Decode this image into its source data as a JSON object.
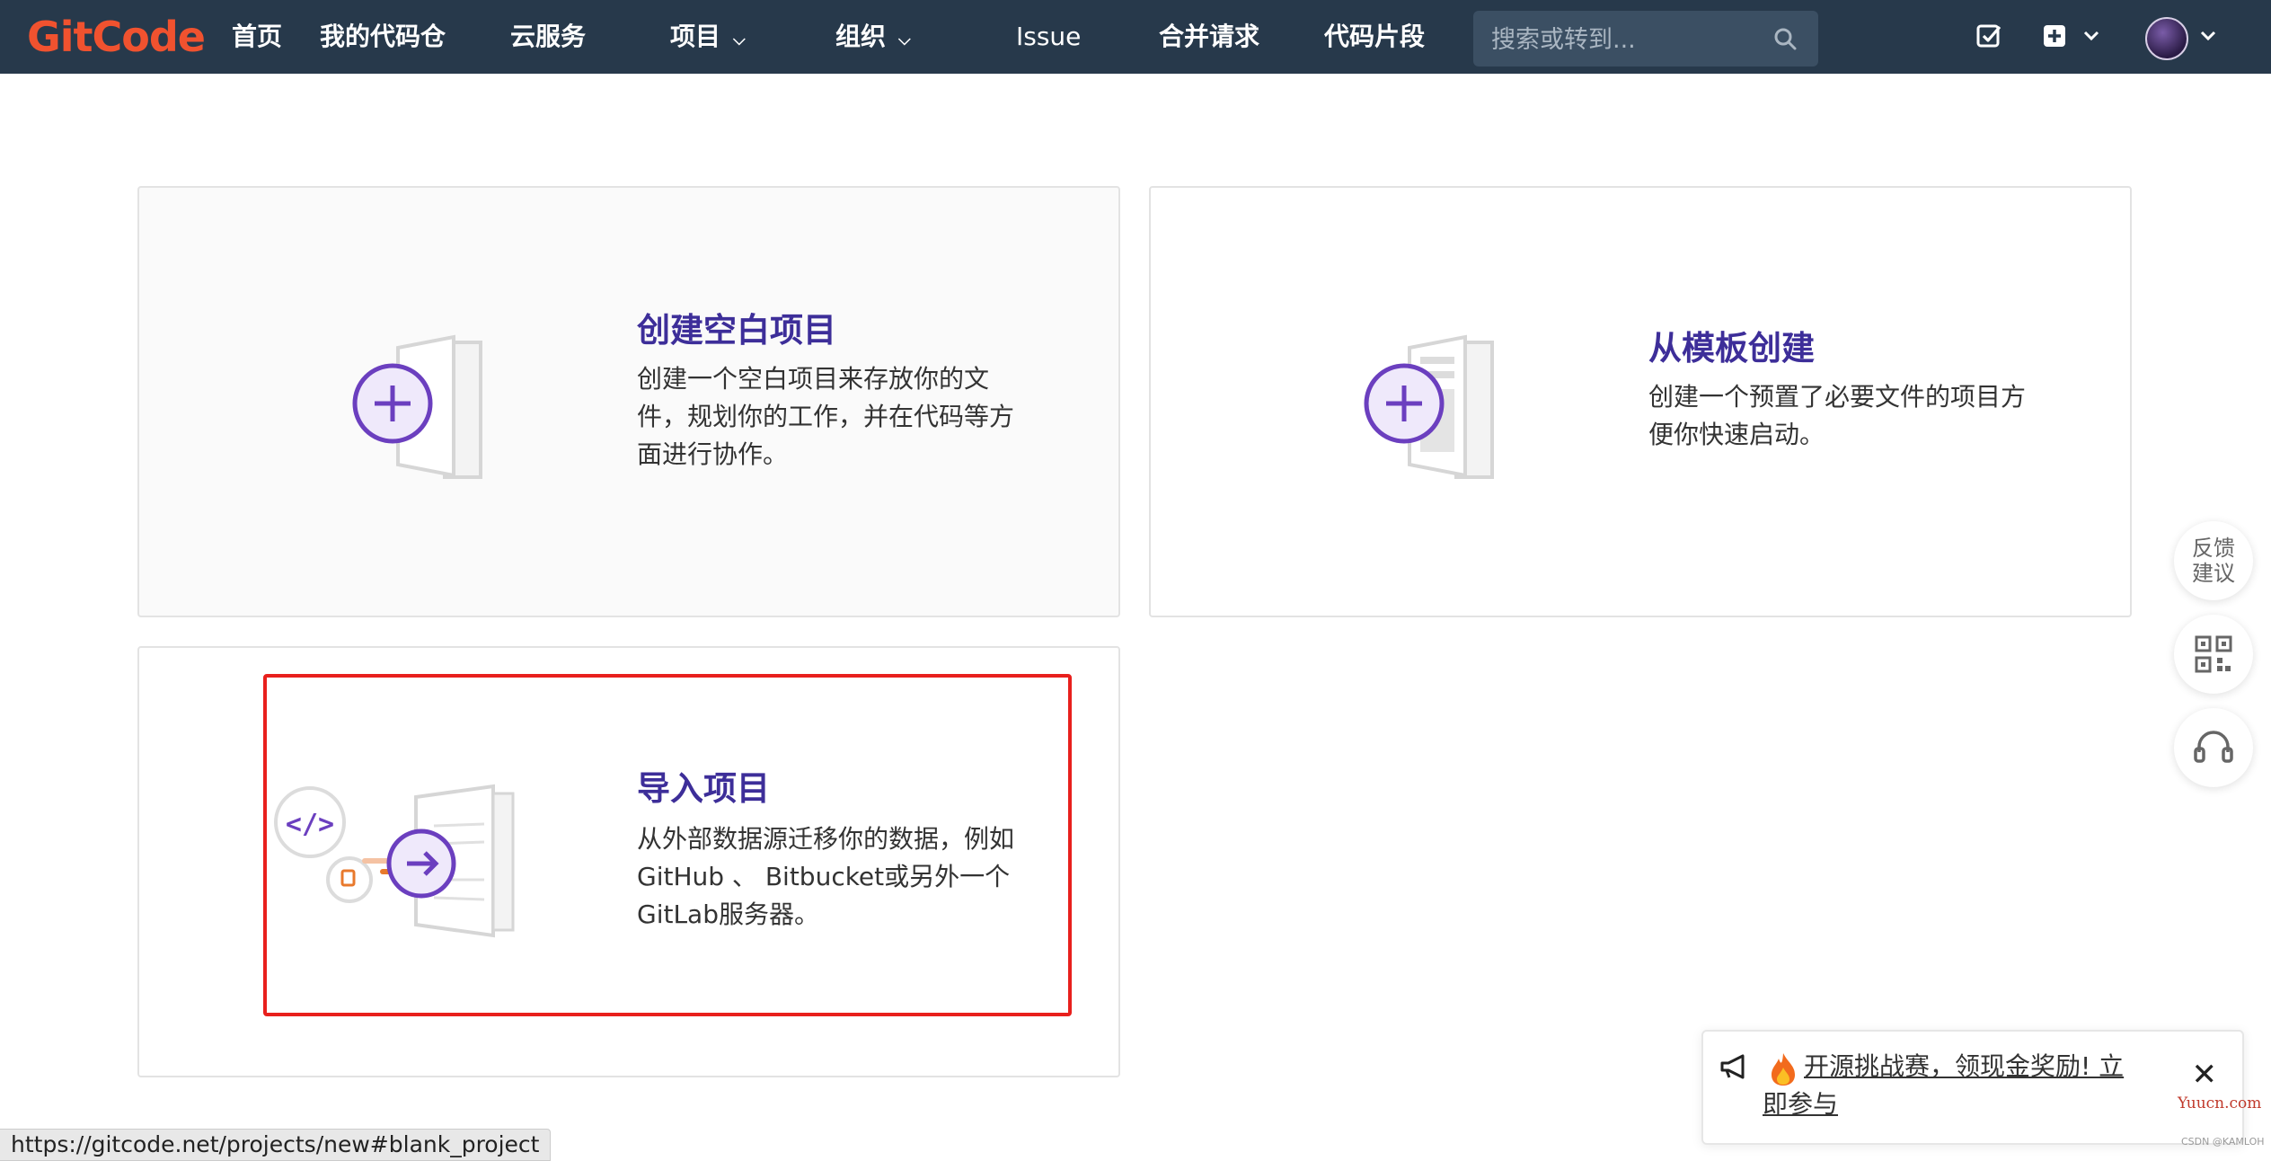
{
  "header": {
    "logo": "GitCode",
    "nav": [
      {
        "label": "首页"
      },
      {
        "label": "我的代码仓"
      },
      {
        "label": "云服务"
      },
      {
        "label": "项目"
      },
      {
        "label": "组织"
      },
      {
        "label": "Issue"
      },
      {
        "label": "合并请求"
      },
      {
        "label": "代码片段"
      }
    ],
    "search_placeholder": "搜索或转到..."
  },
  "cards": [
    {
      "title": "创建空白项目",
      "desc": "创建一个空白项目来存放你的文件，规划你的工作，并在代码等方面进行协作。"
    },
    {
      "title": "从模板创建",
      "desc": "创建一个预置了必要文件的项目方便你快速启动。"
    },
    {
      "title": "导入项目",
      "desc": "从外部数据源迁移你的数据，例如 GitHub 、 Bitbucket或另外一个GitLab服务器。"
    }
  ],
  "float": {
    "feedback": "反馈建议"
  },
  "toast": {
    "text": "开源挑战赛，领现金奖励! 立即参与"
  },
  "status_url": "https://gitcode.net/projects/new#blank_project",
  "watermark": {
    "site": "Yuucn.com",
    "credit": "CSDN @KAMLOH"
  },
  "colors": {
    "nav_bg": "#27394b",
    "accent": "#3d2e99",
    "logo": "#f0522f",
    "highlight": "#e8201d"
  }
}
